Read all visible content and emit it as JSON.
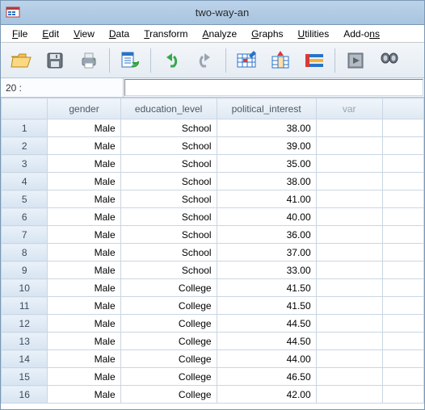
{
  "title": "two-way-an",
  "menus": {
    "file": {
      "pre": "F",
      "ul": "ile"
    },
    "edit": {
      "pre": "E",
      "ul": "dit"
    },
    "view": {
      "pre": "V",
      "ul": "iew"
    },
    "data": {
      "pre": "D",
      "ul": "ata"
    },
    "transform": {
      "pre": "T",
      "ul": "ransform"
    },
    "analyze": {
      "pre": "A",
      "ul": "nalyze"
    },
    "graphs": {
      "pre": "G",
      "ul": "raphs"
    },
    "utilities": {
      "pre": "U",
      "ul": "tilities"
    },
    "addons": {
      "pre": "Add-o",
      "ul": "ns"
    }
  },
  "cell_ref": "20 :",
  "cell_val": "",
  "columns": {
    "c1": "gender",
    "c2": "education_level",
    "c3": "political_interest",
    "c4": "var",
    "c5": ""
  },
  "rows": [
    {
      "n": "1",
      "gender": "Male",
      "edu": "School",
      "pol": "38.00"
    },
    {
      "n": "2",
      "gender": "Male",
      "edu": "School",
      "pol": "39.00"
    },
    {
      "n": "3",
      "gender": "Male",
      "edu": "School",
      "pol": "35.00"
    },
    {
      "n": "4",
      "gender": "Male",
      "edu": "School",
      "pol": "38.00"
    },
    {
      "n": "5",
      "gender": "Male",
      "edu": "School",
      "pol": "41.00"
    },
    {
      "n": "6",
      "gender": "Male",
      "edu": "School",
      "pol": "40.00"
    },
    {
      "n": "7",
      "gender": "Male",
      "edu": "School",
      "pol": "36.00"
    },
    {
      "n": "8",
      "gender": "Male",
      "edu": "School",
      "pol": "37.00"
    },
    {
      "n": "9",
      "gender": "Male",
      "edu": "School",
      "pol": "33.00"
    },
    {
      "n": "10",
      "gender": "Male",
      "edu": "College",
      "pol": "41.50"
    },
    {
      "n": "11",
      "gender": "Male",
      "edu": "College",
      "pol": "41.50"
    },
    {
      "n": "12",
      "gender": "Male",
      "edu": "College",
      "pol": "44.50"
    },
    {
      "n": "13",
      "gender": "Male",
      "edu": "College",
      "pol": "44.50"
    },
    {
      "n": "14",
      "gender": "Male",
      "edu": "College",
      "pol": "44.00"
    },
    {
      "n": "15",
      "gender": "Male",
      "edu": "College",
      "pol": "46.50"
    },
    {
      "n": "16",
      "gender": "Male",
      "edu": "College",
      "pol": "42.00"
    }
  ]
}
